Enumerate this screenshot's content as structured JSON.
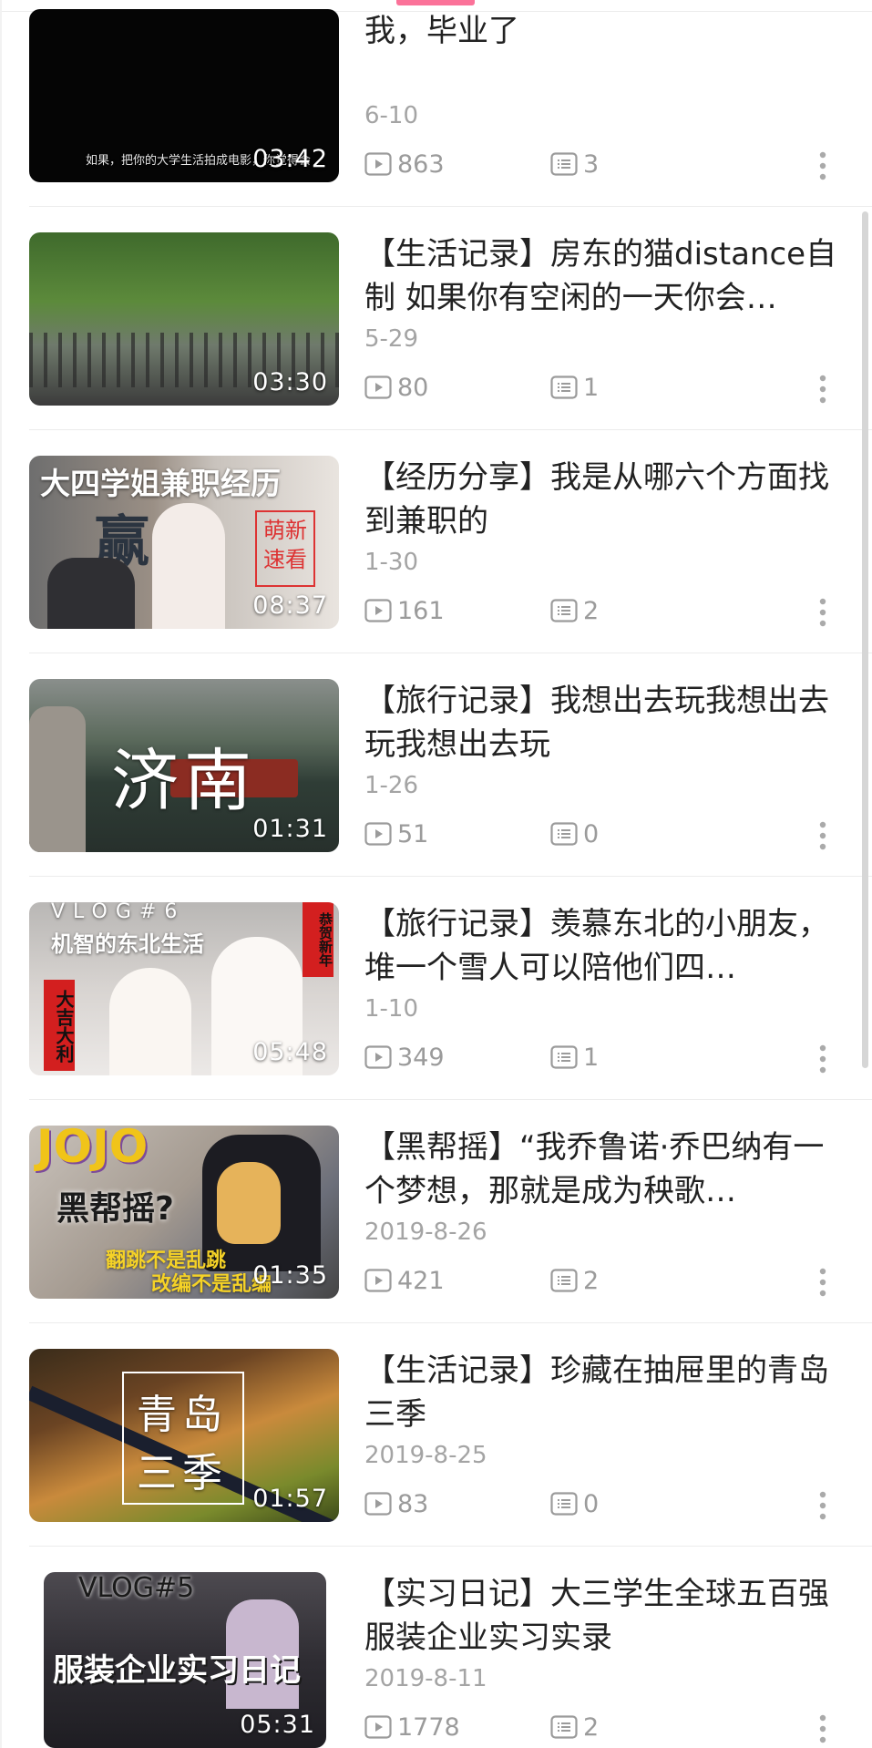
{
  "videos": [
    {
      "title": "我，毕业了",
      "date": "6-10",
      "views": "863",
      "comments": "3",
      "duration": "03:42",
      "thumb_caption": "如果，把你的大学生活拍成电影，你觉得会",
      "thumb_bg": "#050505"
    },
    {
      "title": "【生活记录】房东的猫distance自制 如果你有空闲的一天你会…",
      "date": "5-29",
      "views": "80",
      "comments": "1",
      "duration": "03:30",
      "thumb_caption": "",
      "thumb_bg": "#4f6b3c"
    },
    {
      "title": "【经历分享】我是从哪六个方面找到兼职的",
      "date": "1-30",
      "views": "161",
      "comments": "2",
      "duration": "08:37",
      "thumb_caption": "大四学姐兼职经历",
      "thumb_caption2": "萌新速看",
      "thumb_caption3": "赢",
      "thumb_bg": "#7a736c"
    },
    {
      "title": "【旅行记录】我想出去玩我想出去玩我想出去玩",
      "date": "1-26",
      "views": "51",
      "comments": "0",
      "duration": "01:31",
      "thumb_caption": "济南",
      "thumb_bg": "#3c4a40"
    },
    {
      "title": "【旅行记录】羡慕东北的小朋友，堆一个雪人可以陪他们四…",
      "date": "1-10",
      "views": "349",
      "comments": "1",
      "duration": "05:48",
      "thumb_caption": "VLOG#6",
      "thumb_caption2": "机智的东北生活",
      "thumb_caption3": "大吉大利",
      "thumb_caption4": "恭贺新年",
      "thumb_bg": "#d9d4d2"
    },
    {
      "title": "【黑帮摇】“我乔鲁诺·乔巴纳有一个梦想，那就是成为秧歌…",
      "date": "2019-8-26",
      "views": "421",
      "comments": "2",
      "duration": "01:35",
      "thumb_caption": "JOJO",
      "thumb_caption2": "黑帮摇?",
      "thumb_caption3": "翻跳不是乱跳",
      "thumb_caption4": "改编不是乱编",
      "thumb_bg": "#b8b0a8"
    },
    {
      "title": "【生活记录】珍藏在抽屉里的青岛三季",
      "date": "2019-8-25",
      "views": "83",
      "comments": "0",
      "duration": "01:57",
      "thumb_caption": "青岛",
      "thumb_caption2": "三季",
      "thumb_bg": "#8a5a2c"
    },
    {
      "title": "【实习日记】大三学生全球五百强服装企业实习实录",
      "date": "2019-8-11",
      "views": "1778",
      "comments": "2",
      "duration": "05:31",
      "thumb_caption": "VLOG#5",
      "thumb_caption2": "服装企业实习日记",
      "thumb_bg": "#3e3b40"
    }
  ],
  "icons": {
    "views": "play-count-icon",
    "comments": "comment-count-icon",
    "more": "more-vertical-icon"
  },
  "colors": {
    "accent": "#fb7299",
    "title": "#222222",
    "meta": "#9b9b9b"
  }
}
